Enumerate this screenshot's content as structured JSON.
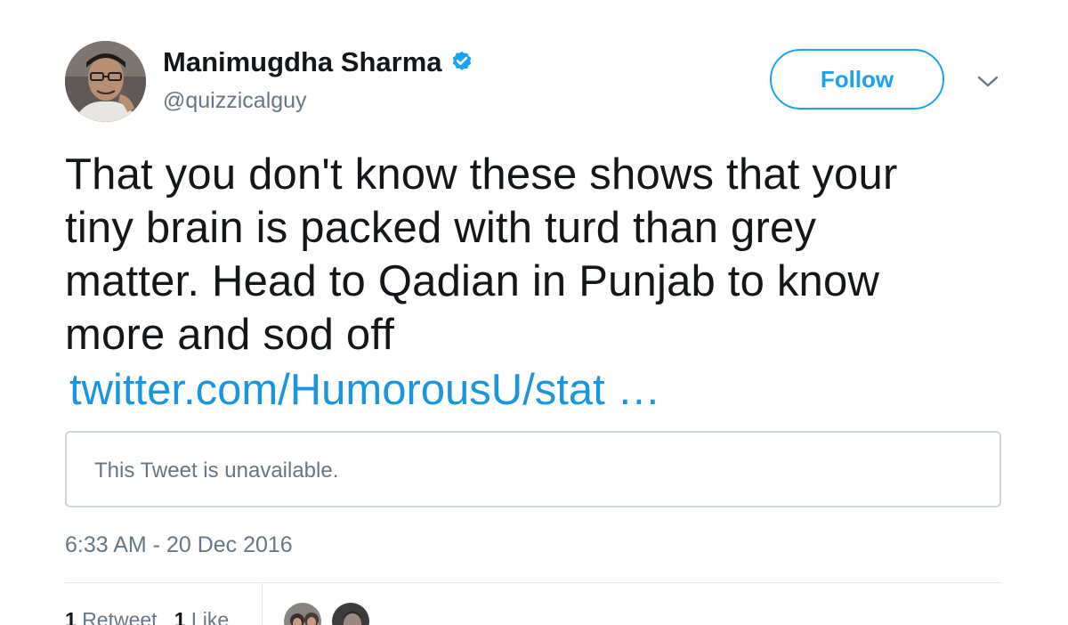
{
  "author": {
    "display_name": "Manimugdha Sharma",
    "screen_name": "@quizzicalguy",
    "verified_icon": "verified-badge-icon",
    "avatar_icon": "user-avatar"
  },
  "actions": {
    "follow_label": "Follow",
    "caret_icon": "chevron-down-icon"
  },
  "tweet": {
    "text_lines": [
      "That you don't know these shows that your",
      "tiny brain is packed with turd than grey",
      "matter. Head to Qadian in Punjab to know",
      "more and sod off"
    ],
    "link_text": "twitter.com/HumorousU/stat …",
    "quoted_tweet_text": "This Tweet is unavailable.",
    "timestamp": "6:33 AM - 20 Dec 2016"
  },
  "stats": {
    "retweets_count": "1",
    "retweets_label": "Retweet",
    "likes_count": "1",
    "likes_label": "Like"
  },
  "colors": {
    "accent": "#1da1f2",
    "link": "#1b95e0",
    "secondary_text": "#657786",
    "border": "#ccd6dd"
  }
}
